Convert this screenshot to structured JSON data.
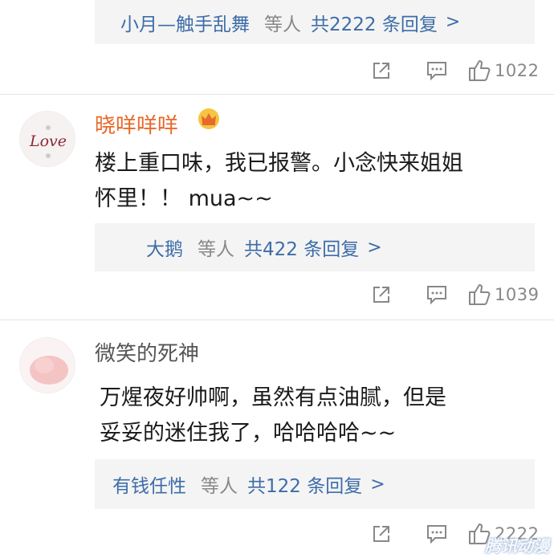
{
  "colors": {
    "link_blue": "#3d6da8",
    "vip_orange": "#e8682a",
    "muted_gray": "#888888",
    "reply_box_bg": "#f4f4f4"
  },
  "comments": [
    {
      "reply_summary": {
        "name": "小月—触手乱舞",
        "etc_label": "等人",
        "count_label": "共2222 条回复",
        "chevron": ">"
      },
      "actions": {
        "share_icon": "share-icon",
        "comment_icon": "comment-icon",
        "like_icon": "thumbs-up-icon",
        "like_count": "1022"
      }
    },
    {
      "username": "晓咩咩咩",
      "badge_icon": "crown-icon",
      "avatar_text": "Love",
      "text_lines": [
        "楼上重口味，我已报警。小念快来姐姐",
        "怀里！！ mua~~"
      ],
      "reply_summary": {
        "name": "大鹅",
        "etc_label": "等人",
        "count_label": "共422 条回复",
        "chevron": ">"
      },
      "actions": {
        "share_icon": "share-icon",
        "comment_icon": "comment-icon",
        "like_icon": "thumbs-up-icon",
        "like_count": "1039"
      }
    },
    {
      "username": "微笑的死神",
      "text_lines": [
        "万煋夜好帅啊，虽然有点油腻，但是",
        "妥妥的迷住我了，哈哈哈哈~~"
      ],
      "reply_summary": {
        "name": "有钱任性",
        "etc_label": "等人",
        "count_label": "共122 条回复",
        "chevron": ">"
      },
      "actions": {
        "share_icon": "share-icon",
        "comment_icon": "comment-icon",
        "like_icon": "thumbs-up-icon",
        "like_count": "2222"
      }
    }
  ],
  "watermark": "腾讯动漫"
}
